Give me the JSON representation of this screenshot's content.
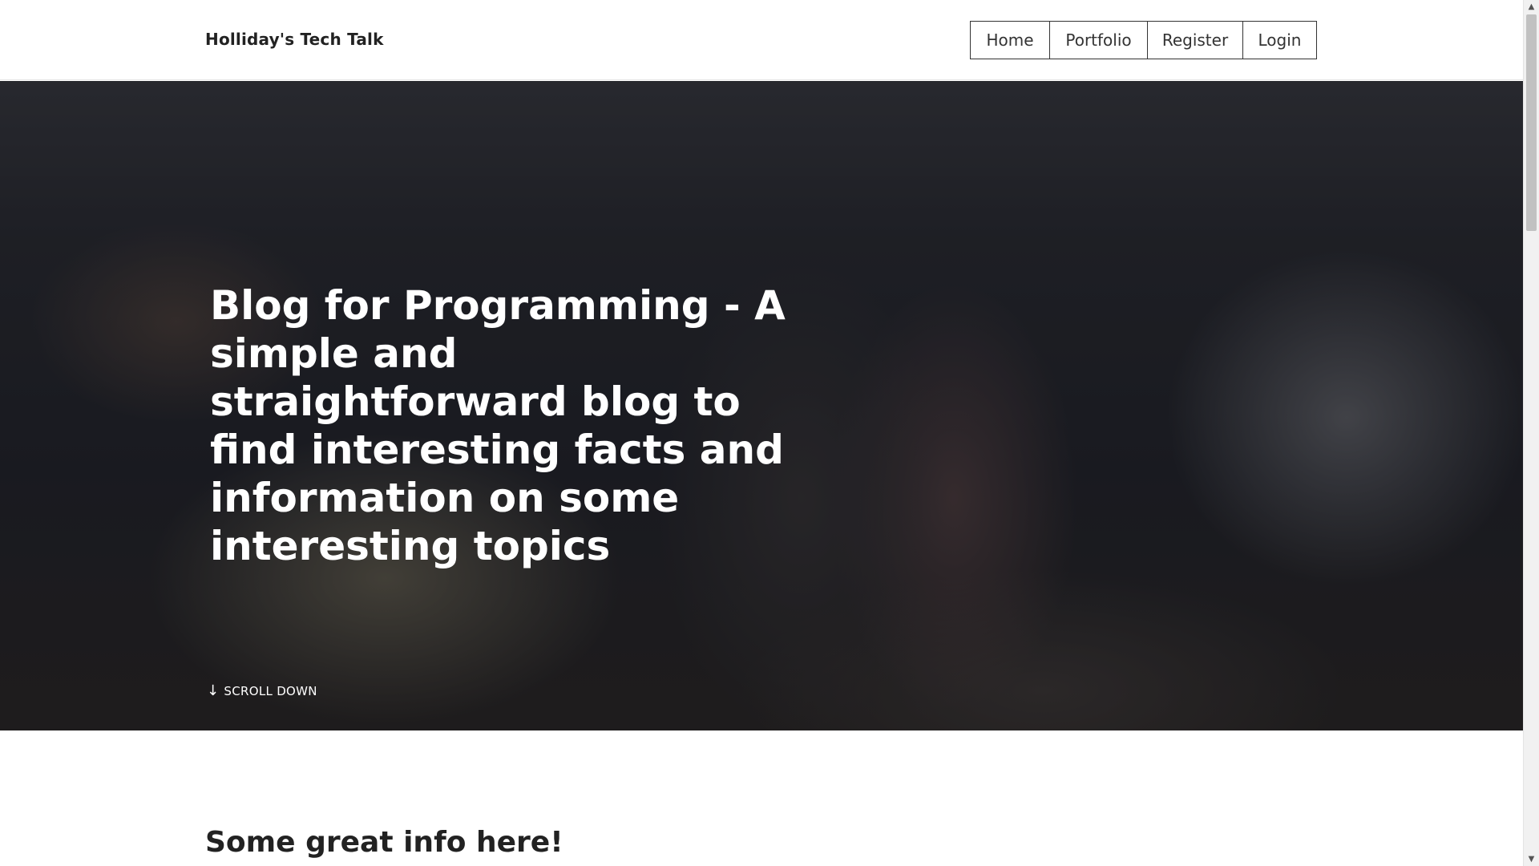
{
  "header": {
    "brand": "Holliday's Tech Talk",
    "nav": [
      "Home",
      "Portfolio",
      "Register",
      "Login"
    ]
  },
  "hero": {
    "title": "Blog for Programming - A simple and straightforward blog to find interesting facts and information on some interesting topics",
    "scroll_label": "SCROLL DOWN",
    "scroll_icon": "arrow-down-icon"
  },
  "content": {
    "section_title": "Some great info here!"
  },
  "colors": {
    "text_dark": "#222222",
    "hero_overlay": "#1a1b22",
    "hero_text": "#ffffff"
  }
}
